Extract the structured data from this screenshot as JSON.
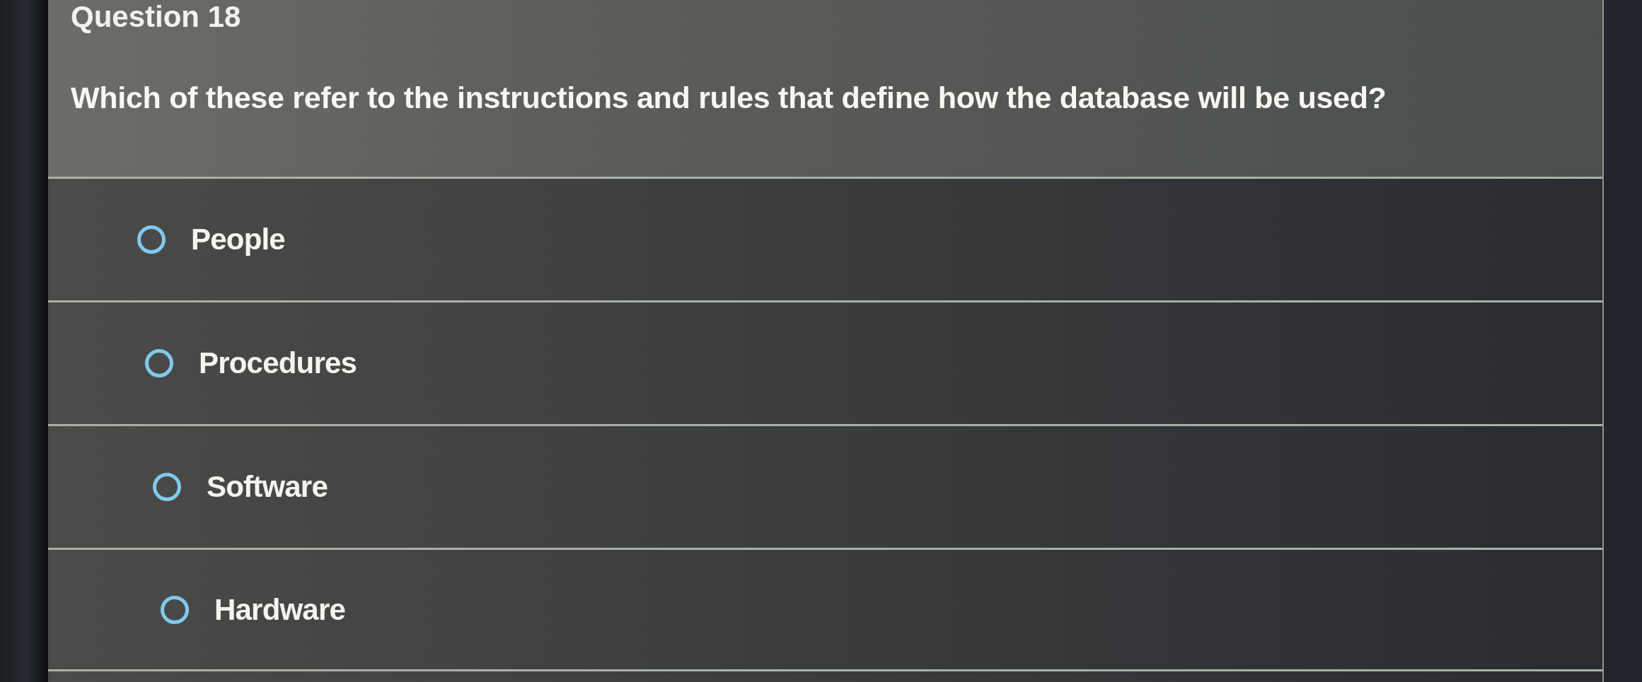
{
  "question": {
    "title": "Question 18",
    "text": "Which of these refer to the instructions and rules that define how the database will be used?"
  },
  "options": [
    {
      "label": "People",
      "selected": false
    },
    {
      "label": "Procedures",
      "selected": false
    },
    {
      "label": "Software",
      "selected": false
    },
    {
      "label": "Hardware",
      "selected": false
    }
  ]
}
